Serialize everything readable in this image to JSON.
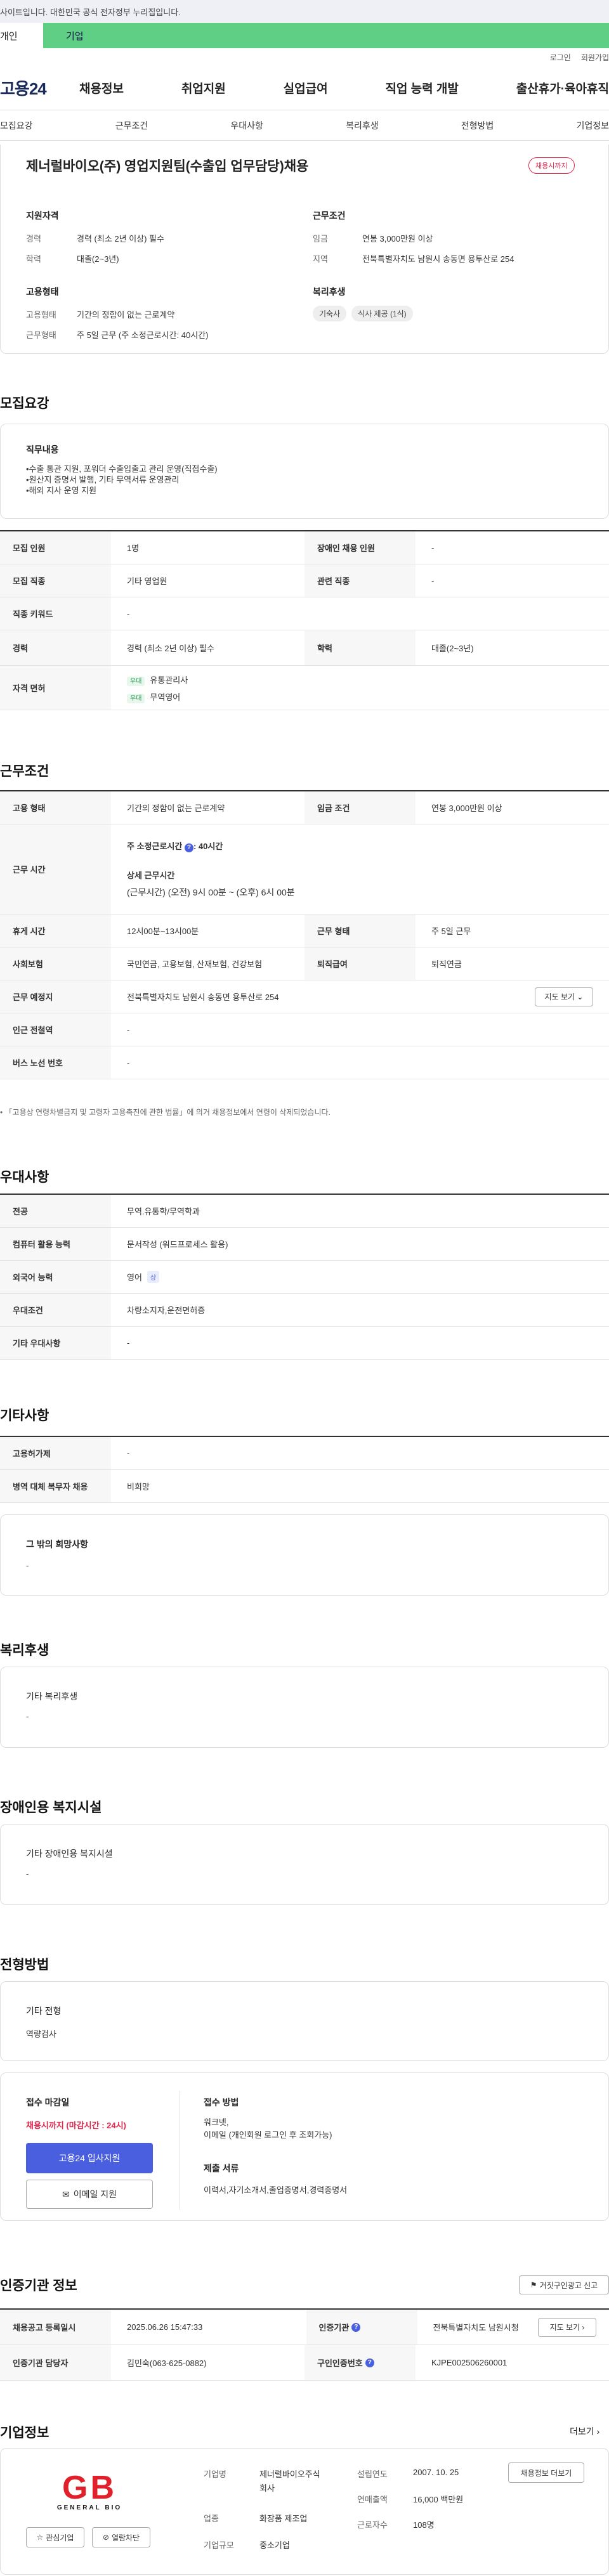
{
  "banner": {
    "text": "사이트입니다. 대한민국 공식 전자정부 누리집입니다."
  },
  "tabs": {
    "personal": "개인",
    "company": "기업"
  },
  "util": {
    "login": "로그인",
    "join": "회원가입"
  },
  "gnb": {
    "logo": "고용24",
    "menu": [
      "채용정보",
      "취업지원",
      "실업급여",
      "직업 능력 개발",
      "출산휴가·육아휴직"
    ]
  },
  "subnav": [
    "모집요강",
    "근무조건",
    "우대사항",
    "복리후생",
    "전형방법",
    "기업정보"
  ],
  "job": {
    "title": "제너럴바이오(주) 영업지원팀(수출입 업무담당)채용",
    "badge": "채용시까지",
    "qual_head": "지원자격",
    "career_lbl": "경력",
    "career_val": "경력 (최소 2년 이상) 필수",
    "edu_lbl": "학력",
    "edu_val": "대졸(2~3년)",
    "cond_head": "근무조건",
    "wage_lbl": "임금",
    "wage_val": "연봉 3,000만원 이상",
    "region_lbl": "지역",
    "region_val": "전북특별자치도 남원시 송동면 용투산로 254",
    "emp_head": "고용형태",
    "emptype_lbl": "고용형태",
    "emptype_val": "기간의 정함이 없는 근로계약",
    "worktype_lbl": "근무형태",
    "worktype_val": "주 5일 근무 (주 소정근로시간: 40시간)",
    "welfare_head": "복리후생",
    "welfare_chips": [
      "기숙사",
      "식사 제공 (1식)"
    ]
  },
  "recruit": {
    "heading": "모집요강",
    "duty_head": "직무내용",
    "duty_lines": [
      "•수출 통관 지원, 포워더 수출입출고 관리 운영(직접수출)",
      "•원산지 증명서 발행, 기타 무역서류 운영관리",
      "•해외 지사 운영 지원"
    ],
    "rows": [
      {
        "l1": "모집 인원",
        "v1": "1명",
        "l2": "장애인 채용 인원",
        "v2": "-"
      },
      {
        "l1": "모집 직종",
        "v1": "기타 영업원",
        "l2": "관련 직종",
        "v2": "-"
      },
      {
        "l1": "직종 키워드",
        "v1": "-"
      },
      {
        "l1": "경력",
        "v1": "경력 (최소 2년 이상) 필수",
        "l2": "학력",
        "v2": "대졸(2~3년)"
      }
    ],
    "license_lbl": "자격 면허",
    "licenses": [
      {
        "tag": "우대",
        "name": "유통관리사"
      },
      {
        "tag": "우대",
        "name": "무역영어"
      }
    ]
  },
  "conditions": {
    "heading": "근무조건",
    "emp_lbl": "고용 형태",
    "emp_val": "기간의 정함이 없는 근로계약",
    "wage_lbl": "임금 조건",
    "wage_val": "연봉 3,000만원 이상",
    "time_lbl": "근무 시간",
    "time_hours": "주 소정근로시간",
    "time_hours_val": ": 40시간",
    "detail_head": "상세 근무시간",
    "detail_val": "(근무시간) (오전) 9시 00분 ~ (오후) 6시 00분",
    "rest_lbl": "휴게 시간",
    "rest_val": "12시00분~13시00분",
    "form_lbl": "근무 형태",
    "form_val": "주 5일 근무",
    "ins_lbl": "사회보험",
    "ins_val": "국민연금, 고용보험, 산재보험, 건강보험",
    "sev_lbl": "퇴직급여",
    "sev_val": "퇴직연금",
    "place_lbl": "근무 예정지",
    "place_val": "전북특별자치도 남원시 송동면 용투산로 254",
    "map_btn": "지도 보기",
    "subway_lbl": "인근 전철역",
    "subway_val": "-",
    "bus_lbl": "버스 노선 번호",
    "bus_val": "-",
    "note": "「고용상 연령차별금지 및 고령자 고용촉진에 관한 법률」에 의거 채용정보에서 연령이 삭제되었습니다."
  },
  "prefer": {
    "heading": "우대사항",
    "rows": [
      {
        "l": "전공",
        "v": "무역.유통학/무역학과"
      },
      {
        "l": "컴퓨터 활용 능력",
        "v": "문서작성 (워드프로세스 활용)"
      },
      {
        "l": "외국어 능력",
        "v": "영어",
        "badge": "상"
      },
      {
        "l": "우대조건",
        "v": "차량소지자,운전면허증"
      },
      {
        "l": "기타 우대사항",
        "v": "-"
      }
    ]
  },
  "etc": {
    "heading": "기타사항",
    "rows": [
      {
        "l": "고용허가제",
        "v": "-"
      },
      {
        "l": "병역 대체 복무자 채용",
        "v": "비희망"
      }
    ],
    "other_head": "그 밖의 희망사항",
    "other_val": "-"
  },
  "welfare": {
    "heading": "복리후생",
    "sub": "기타 복리후생",
    "val": "-"
  },
  "disabled": {
    "heading": "장애인용 복지시설",
    "sub": "기타 장애인용 복지시설",
    "val": "-"
  },
  "selection": {
    "heading": "전형방법",
    "sub": "기타 전형",
    "val": "역량검사",
    "deadline_head": "접수 마감일",
    "deadline_val": "채용시까지 (마감시간 : 24시)",
    "apply_btn": "고용24 입사지원",
    "email_btn": "이메일 지원",
    "method_head": "접수 방법",
    "method_lines": [
      "워크넷,",
      "이메일 (개인회원 로그인 후 조회가능)"
    ],
    "docs_head": "제출 서류",
    "docs_val": "이력서,자기소개서,졸업증명서,경력증명서"
  },
  "agency": {
    "heading": "인증기관 정보",
    "report_btn": "거짓구인광고 신고",
    "reg_lbl": "채용공고 등록일시",
    "reg_val": "2025.06.26 15:47:33",
    "org_lbl": "인증기관",
    "org_val": "전북특별자치도 남원시청",
    "map_btn": "지도 보기",
    "mgr_lbl": "인증기관 담당자",
    "mgr_val": "김민숙(063-625-0882)",
    "no_lbl": "구인인증번호",
    "no_val": "KJPE002506260001"
  },
  "company": {
    "heading": "기업정보",
    "more": "더보기",
    "logo_main": "GB",
    "logo_sub": "GENERAL BIO",
    "fav_btn": "관심기업",
    "block_btn": "열람차단",
    "name_lbl": "기업명",
    "name_val_1": "제너럴바이오주식",
    "name_val_2": "회사",
    "ind_lbl": "업종",
    "ind_val": "화장품 제조업",
    "size_lbl": "기업규모",
    "size_val": "중소기업",
    "found_lbl": "설립연도",
    "found_val": "2007. 10. 25",
    "sales_lbl": "연매출액",
    "sales_val": "16,000 백만원",
    "emp_lbl": "근로자수",
    "emp_val": "108명",
    "jobs_btn": "채용정보 더보기"
  },
  "colors": {
    "accent_green": "#5fcf86",
    "primary_blue": "#4a5fe0",
    "danger_red": "#e0284f"
  }
}
